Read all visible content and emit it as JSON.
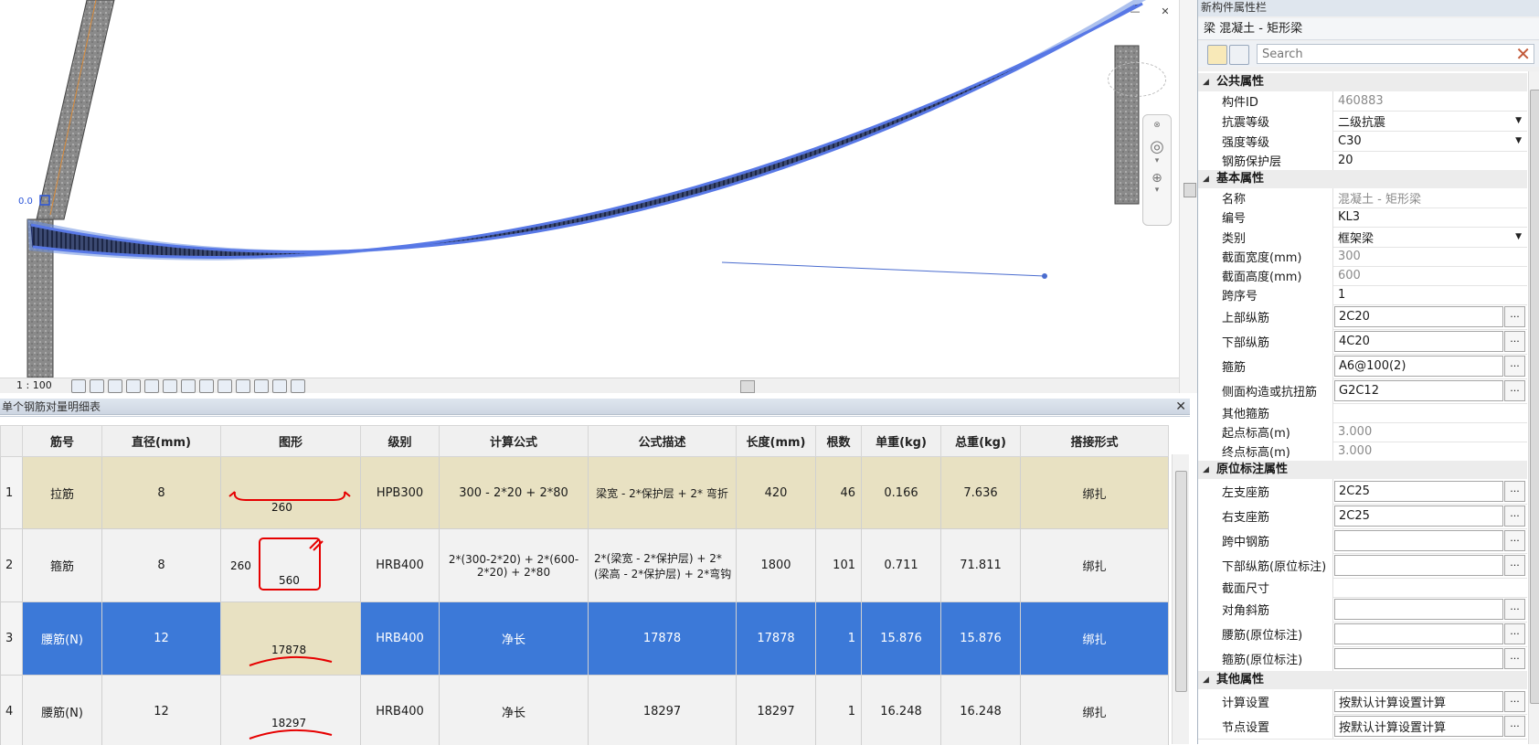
{
  "viewport": {
    "scale_label": "1 : 100",
    "annotation_label": "0.0",
    "controls": {
      "minimize_icon": "—",
      "close_icon": "✕"
    }
  },
  "table_panel": {
    "title": "单个钢筋对量明细表",
    "close_icon": "✕",
    "headers": [
      "",
      "筋号",
      "直径(mm)",
      "图形",
      "级别",
      "计算公式",
      "公式描述",
      "长度(mm)",
      "根数",
      "单重(kg)",
      "总重(kg)",
      "搭接形式"
    ],
    "rows": [
      {
        "index": "1",
        "name": "拉筋",
        "diameter": "8",
        "shape_labels": [
          "260"
        ],
        "grade": "HPB300",
        "formula": "300 - 2*20 + 2*80",
        "description": "梁宽 - 2*保护层 + 2* 弯折",
        "length": "420",
        "count": "46",
        "unit_weight": "0.166",
        "total_weight": "7.636",
        "splice": "绑扎"
      },
      {
        "index": "2",
        "name": "箍筋",
        "diameter": "8",
        "shape_labels": [
          "260",
          "560"
        ],
        "grade": "HRB400",
        "formula": "2*(300-2*20) + 2*(600-2*20) + 2*80",
        "description": "2*(梁宽 - 2*保护层) + 2*(梁高 - 2*保护层) + 2*弯钩",
        "length": "1800",
        "count": "101",
        "unit_weight": "0.711",
        "total_weight": "71.811",
        "splice": "绑扎"
      },
      {
        "index": "3",
        "name": "腰筋(N)",
        "diameter": "12",
        "shape_labels": [
          "17878"
        ],
        "grade": "HRB400",
        "formula": "净长",
        "description": "17878",
        "length": "17878",
        "count": "1",
        "unit_weight": "15.876",
        "total_weight": "15.876",
        "splice": "绑扎"
      },
      {
        "index": "4",
        "name": "腰筋(N)",
        "diameter": "12",
        "shape_labels": [
          "18297"
        ],
        "grade": "HRB400",
        "formula": "净长",
        "description": "18297",
        "length": "18297",
        "count": "1",
        "unit_weight": "16.248",
        "total_weight": "16.248",
        "splice": "绑扎"
      }
    ]
  },
  "props": {
    "panel_title": "新构件属性栏",
    "type_label": "梁 混凝土 - 矩形梁",
    "search": {
      "placeholder": "Search",
      "value": ""
    },
    "groups": [
      {
        "name": "公共属性",
        "rows": [
          {
            "label": "构件ID",
            "value": "460883",
            "style": "gray"
          },
          {
            "label": "抗震等级",
            "value": "二级抗震",
            "style": "dropdown"
          },
          {
            "label": "强度等级",
            "value": "C30",
            "style": "dropdown"
          },
          {
            "label": "钢筋保护层",
            "value": "20",
            "style": "plain"
          }
        ]
      },
      {
        "name": "基本属性",
        "rows": [
          {
            "label": "名称",
            "value": "混凝土 - 矩形梁",
            "style": "gray"
          },
          {
            "label": "编号",
            "value": "KL3",
            "style": "plain"
          },
          {
            "label": "类别",
            "value": "框架梁",
            "style": "dropdown"
          },
          {
            "label": "截面宽度(mm)",
            "value": "300",
            "style": "gray"
          },
          {
            "label": "截面高度(mm)",
            "value": "600",
            "style": "gray"
          },
          {
            "label": "跨序号",
            "value": "1",
            "style": "plain"
          },
          {
            "label": "上部纵筋",
            "value": "2C20",
            "style": "box"
          },
          {
            "label": "下部纵筋",
            "value": "4C20",
            "style": "box"
          },
          {
            "label": "箍筋",
            "value": "A6@100(2)",
            "style": "box"
          },
          {
            "label": "侧面构造或抗扭筋",
            "value": "G2C12",
            "style": "box"
          },
          {
            "label": "其他箍筋",
            "value": "",
            "style": "plain"
          },
          {
            "label": "起点标高(m)",
            "value": "3.000",
            "style": "gray"
          },
          {
            "label": "终点标高(m)",
            "value": "3.000",
            "style": "gray"
          }
        ]
      },
      {
        "name": "原位标注属性",
        "rows": [
          {
            "label": "左支座筋",
            "value": "2C25",
            "style": "box"
          },
          {
            "label": "右支座筋",
            "value": "2C25",
            "style": "box"
          },
          {
            "label": "跨中钢筋",
            "value": "",
            "style": "box"
          },
          {
            "label": "下部纵筋(原位标注)",
            "value": "",
            "style": "box"
          },
          {
            "label": "截面尺寸",
            "value": "",
            "style": "plain"
          },
          {
            "label": "对角斜筋",
            "value": "",
            "style": "box"
          },
          {
            "label": "腰筋(原位标注)",
            "value": "",
            "style": "box"
          },
          {
            "label": "箍筋(原位标注)",
            "value": "",
            "style": "box"
          }
        ]
      },
      {
        "name": "其他属性",
        "rows": [
          {
            "label": "计算设置",
            "value": "按默认计算设置计算",
            "style": "box"
          },
          {
            "label": "节点设置",
            "value": "按默认计算设置计算",
            "style": "box"
          }
        ]
      }
    ]
  }
}
